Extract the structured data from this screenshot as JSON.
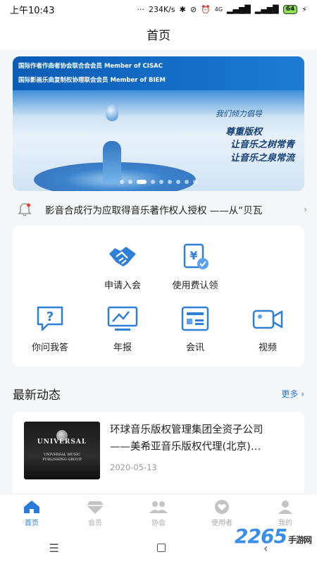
{
  "status_bar": {
    "time": "上午10:43",
    "network_speed": "234K/s",
    "signal_label": "4G",
    "battery": "64"
  },
  "header": {
    "title": "首页"
  },
  "banner": {
    "line1": "国际作者作曲者协会联合会会员 Member of CISAC",
    "line2": "国际影画乐曲复制权协理联会会员 Member of BIEM",
    "slogan_small": "我们倾力倡导",
    "slogan_main": "尊重版权",
    "slogan_2": "让音乐之树常青",
    "slogan_3": "让音乐之泉常流",
    "dot_count": 9,
    "active_dot": 2
  },
  "notice": {
    "text": "影音合成行为应取得音乐著作权人授权 ——从“贝瓦"
  },
  "menu": {
    "items": [
      {
        "label": "申请入会",
        "icon": "handshake-icon"
      },
      {
        "label": "使用费认领",
        "icon": "yen-doc-icon"
      },
      {
        "label": "你问我答",
        "icon": "question-chat-icon"
      },
      {
        "label": "年报",
        "icon": "report-screen-icon"
      },
      {
        "label": "会讯",
        "icon": "news-card-icon"
      },
      {
        "label": "视频",
        "icon": "video-camera-icon"
      }
    ]
  },
  "latest": {
    "title": "最新动态",
    "more": "更多 ›",
    "news": [
      {
        "title_line1": "环球音乐版权管理集团全资子公司",
        "title_line2": "——美希亚音乐版权代理(北京)…",
        "date": "2020-05-13",
        "thumb_brand": "UNIVERSAL",
        "thumb_sub1": "UNIVERSAL MUSIC",
        "thumb_sub2": "PUBLISHING GROUP"
      }
    ]
  },
  "tabbar": {
    "items": [
      {
        "label": "首页",
        "icon": "home-icon",
        "active": true
      },
      {
        "label": "会员",
        "icon": "diamond-icon",
        "active": false
      },
      {
        "label": "协会",
        "icon": "group-icon",
        "active": false
      },
      {
        "label": "使用者",
        "icon": "heart-icon",
        "active": false
      },
      {
        "label": "我的",
        "icon": "person-icon",
        "active": false
      }
    ]
  },
  "watermark": {
    "main": "2265",
    "sub": "手游网"
  },
  "colors": {
    "accent": "#2a7bd8",
    "icon_blue": "#2f7fd6",
    "inactive": "#c4c4c4"
  }
}
